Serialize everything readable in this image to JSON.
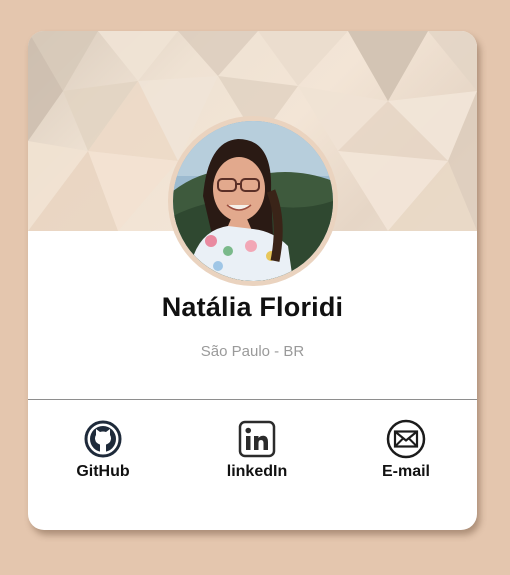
{
  "profile": {
    "name": "Natália Floridi",
    "location": "São Paulo - BR",
    "avatar_alt": "profile photo"
  },
  "links": [
    {
      "label": "GitHub",
      "icon": "github-icon"
    },
    {
      "label": "linkedIn",
      "icon": "linkedin-icon"
    },
    {
      "label": "E-mail",
      "icon": "email-icon"
    }
  ],
  "colors": {
    "page_background": "#e4c6ae",
    "card_background": "#ffffff",
    "avatar_ring": "#ead3bf",
    "name_text": "#111111",
    "location_text": "#9a9a9a"
  }
}
